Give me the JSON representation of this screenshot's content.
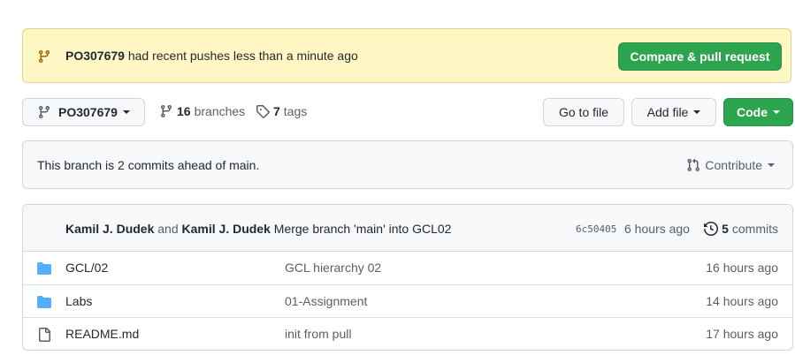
{
  "banner": {
    "branch": "PO307679",
    "message": "had recent pushes less than a minute ago",
    "button": "Compare & pull request",
    "icon": "git-branch-icon"
  },
  "toolbar": {
    "branch_label": "PO307679",
    "branches_count": "16",
    "branches_label": "branches",
    "tags_count": "7",
    "tags_label": "tags",
    "go_to_file": "Go to file",
    "add_file": "Add file",
    "code": "Code"
  },
  "ahead": {
    "text": "This branch is 2 commits ahead of main.",
    "contribute": "Contribute"
  },
  "commit": {
    "author1": "Kamil J. Dudek",
    "and": "and",
    "author2": "Kamil J. Dudek",
    "message": "Merge branch 'main' into GCL02",
    "sha": "6c50405",
    "ago": "6 hours ago",
    "commits_count": "5",
    "commits_label": "commits"
  },
  "files": [
    {
      "icon": "folder-icon",
      "name": "GCL/02",
      "message": "GCL hierarchy 02",
      "age": "16 hours ago"
    },
    {
      "icon": "folder-icon",
      "name": "Labs",
      "message": "01-Assignment",
      "age": "14 hours ago"
    },
    {
      "icon": "file-icon",
      "name": "README.md",
      "message": "init from pull",
      "age": "17 hours ago"
    }
  ],
  "colors": {
    "green": "#2da44e",
    "banner_bg": "#fff8c5",
    "folder": "#54aeff"
  }
}
